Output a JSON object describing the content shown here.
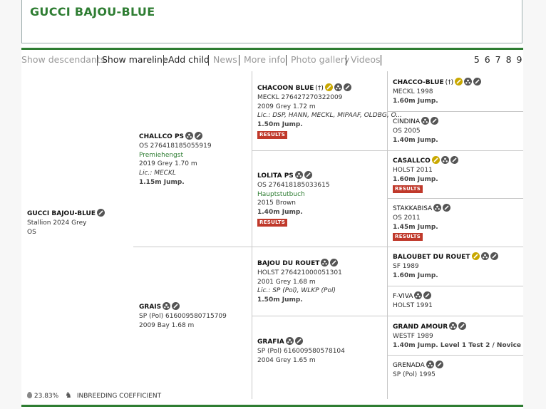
{
  "title": "GUCCI BAJOU-BLUE",
  "nav": {
    "items": [
      "Show descendants",
      "Show mareline",
      "Add child",
      "News",
      "More info",
      "Photo gallery",
      "Videos"
    ],
    "pages": "5 6 7 8 9"
  },
  "subject": {
    "name": "GUCCI BAJOU-BLUE",
    "line1": "Stallion 2024 Grey",
    "line2": "OS"
  },
  "sire": {
    "name": "CHALLCO PS",
    "reg": "OS 276418185055919",
    "status": "Premiehengst",
    "info": "2019 Grey 1.70 m",
    "lic": "Lic.: MECKL",
    "jump": "1.15m Jump."
  },
  "dam": {
    "name": "GRAIS",
    "reg": "SP (Pol) 616009580715709",
    "info": "2009 Bay 1.68 m"
  },
  "ss": {
    "name": "CHACOON BLUE",
    "reg": "MECKL 276427270322009",
    "info": "2009 Grey 1.72 m",
    "lic": "Lic.: DSP, HANN, MECKL, MIPAAF, OLDBG, O...",
    "jump": "1.50m Jump.",
    "button": "RESULTS"
  },
  "sd": {
    "name": "LOLITA PS",
    "reg": "OS 276418185033615",
    "status": "Hauptstutbuch",
    "info": "2015 Brown",
    "jump": "1.40m Jump.",
    "button": "RESULTS"
  },
  "ds": {
    "name": "BAJOU DU ROUET",
    "reg": "HOLST 276421000051301",
    "info": "2001 Grey 1.68 m",
    "lic": "Lic.: SP (Pol), WLKP (Pol)",
    "jump": "1.50m Jump."
  },
  "dd": {
    "name": "GRAFIA",
    "reg": "SP (Pol) 616009580578104",
    "info": "2004 Grey 1.65 m"
  },
  "sss": {
    "name": "CHACCO-BLUE",
    "reg": "MECKL 1998",
    "jump": "1.60m Jump."
  },
  "ssd": {
    "name": "CINDINA",
    "reg": "OS 2005",
    "jump": "1.40m Jump."
  },
  "sds": {
    "name": "CASALLCO",
    "reg": "HOLST 2011",
    "jump": "1.60m Jump.",
    "button": "RESULTS"
  },
  "sdd": {
    "name": "STAKKABISA",
    "reg": "OS 2011",
    "jump": "1.45m Jump.",
    "button": "RESULTS"
  },
  "dss": {
    "name": "BALOUBET DU ROUET",
    "reg": "SF 1989",
    "jump": "1.60m Jump."
  },
  "dsd": {
    "name": "F-VIVA",
    "reg": "HOLST 1991"
  },
  "dds": {
    "name": "GRAND AMOUR",
    "reg": "WESTF 1989",
    "jump": "1.40m Jump. Level 1 Test 2 / Novice"
  },
  "ddd": {
    "name": "GRENADA",
    "reg": "SP (Pol) 1995"
  },
  "footer": {
    "coefficient": "23.83%",
    "label": "INBREEDING COEFFICIENT"
  },
  "colors": {
    "accent": "#2e7d32",
    "results": "#c0392b",
    "gold": "#c9a800"
  }
}
